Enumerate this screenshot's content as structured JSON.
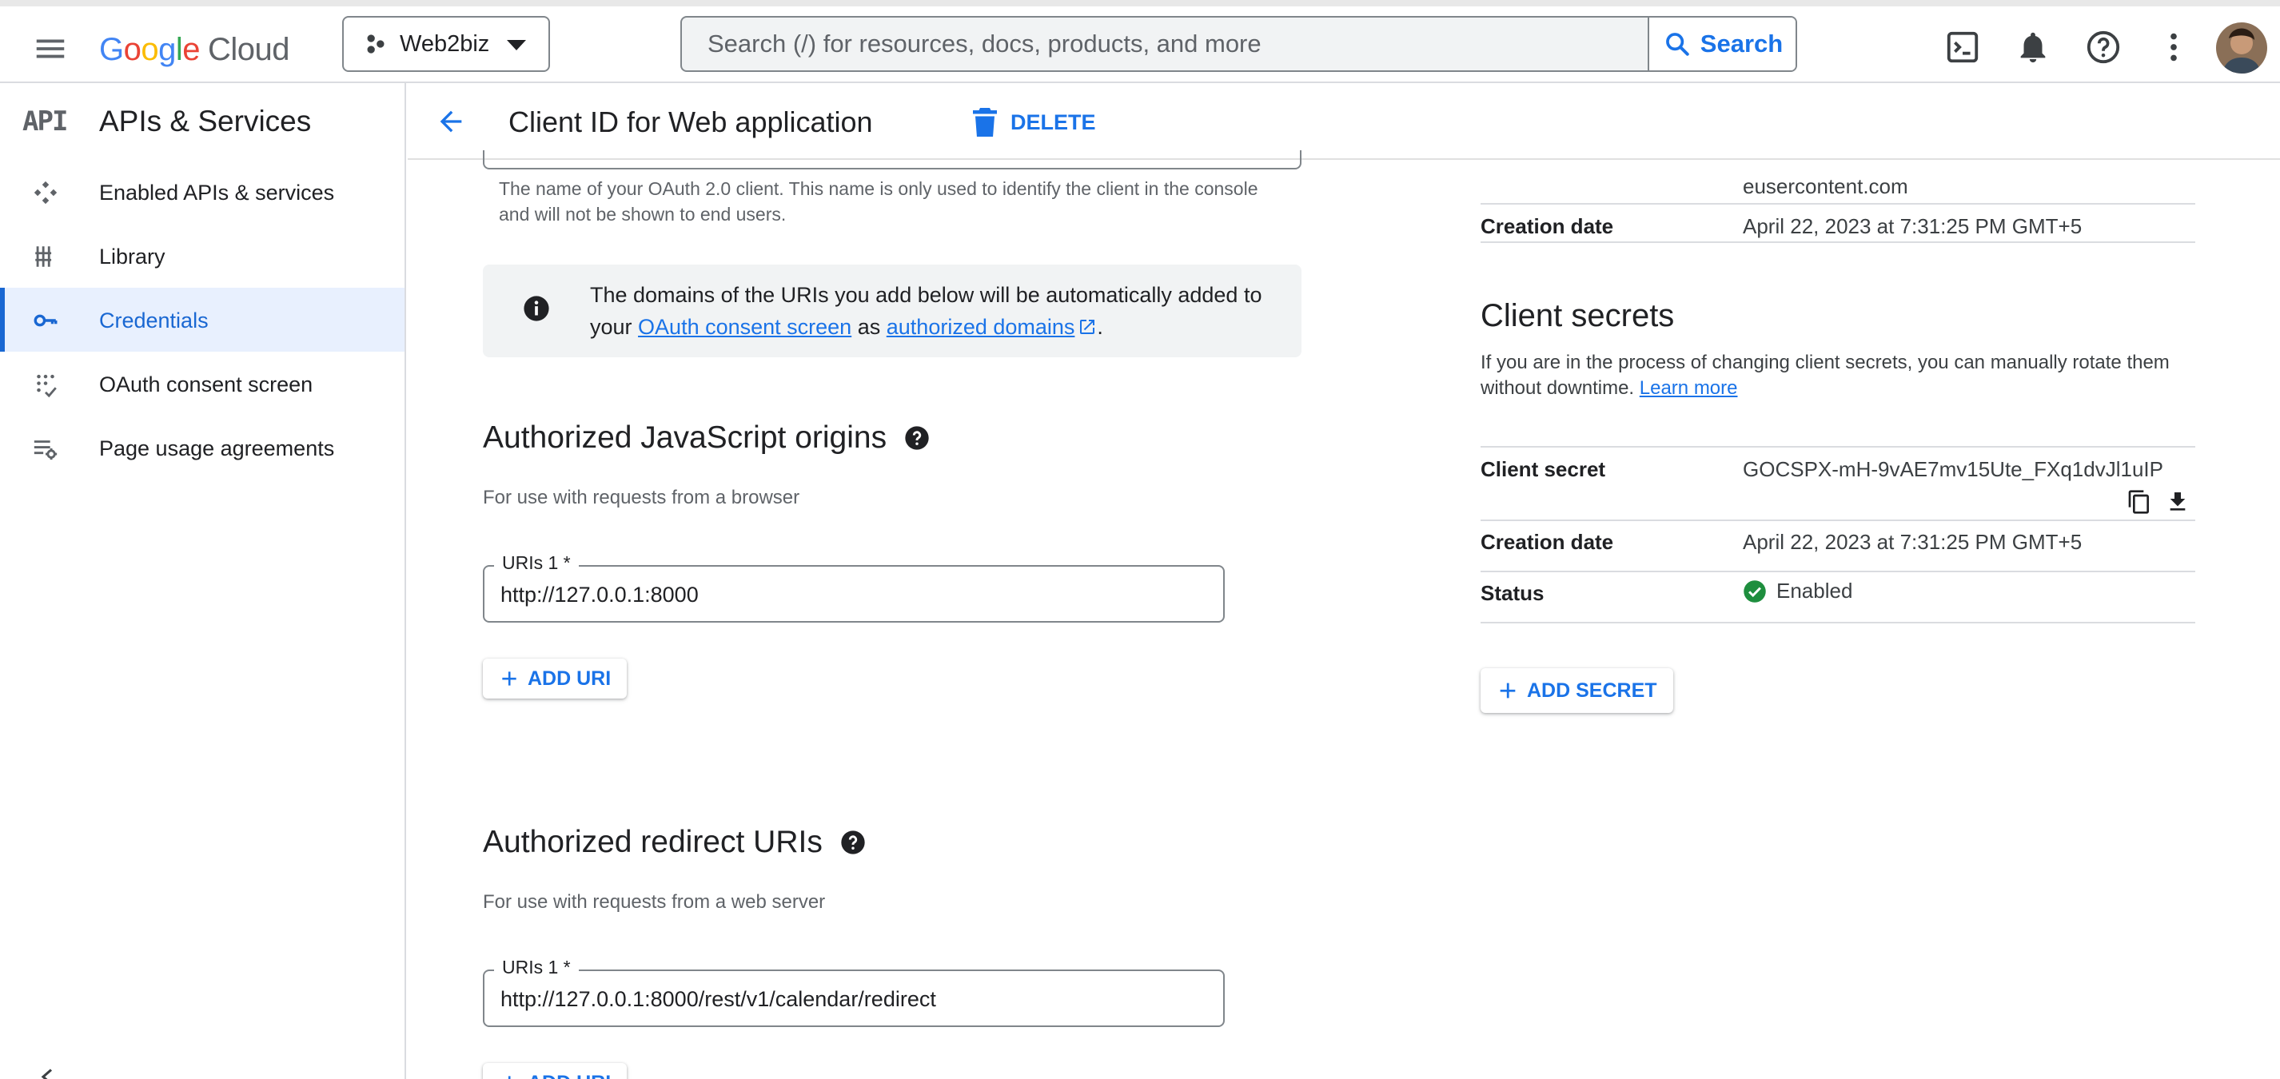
{
  "topbar": {
    "logo_google": "Google",
    "logo_cloud": "Cloud",
    "project": "Web2biz",
    "search_placeholder": "Search (/) for resources, docs, products, and more",
    "search_button": "Search",
    "icons": [
      "cloud-shell-icon",
      "notifications-icon",
      "help-icon",
      "more-vert-icon"
    ]
  },
  "sidebar": {
    "badge": "API",
    "title": "APIs & Services",
    "items": [
      {
        "label": "Enabled APIs & services",
        "icon": "enabled-apis-icon"
      },
      {
        "label": "Library",
        "icon": "library-icon"
      },
      {
        "label": "Credentials",
        "icon": "key-icon",
        "active": true
      },
      {
        "label": "OAuth consent screen",
        "icon": "consent-icon"
      },
      {
        "label": "Page usage agreements",
        "icon": "settings-list-icon"
      }
    ]
  },
  "header": {
    "title": "Client ID for Web application",
    "delete_label": "DELETE"
  },
  "left": {
    "name_helper": "The name of your OAuth 2.0 client. This name is only used to identify the client in the console and will not be shown to end users.",
    "info_text_1": "The domains of the URIs you add below will be automatically added to your",
    "info_link_1": "OAuth consent screen",
    "info_text_2": "as",
    "info_link_2": "authorized domains",
    "info_text_3": ".",
    "js_origins": {
      "title": "Authorized JavaScript origins",
      "subtitle": "For use with requests from a browser",
      "field_label": "URIs 1 *",
      "field_value": "http://127.0.0.1:8000",
      "add_label": "ADD URI"
    },
    "redirect": {
      "title": "Authorized redirect URIs",
      "subtitle": "For use with requests from a web server",
      "field_label": "URIs 1 *",
      "field_value": "http://127.0.0.1:8000/rest/v1/calendar/redirect",
      "add_label": "ADD URI"
    }
  },
  "right": {
    "client_id_tail": "eusercontent.com",
    "client_creation_label": "Creation date",
    "client_creation_value": "April 22, 2023 at 7:31:25 PM GMT+5",
    "secrets_title": "Client secrets",
    "secrets_desc": "If you are in the process of changing client secrets, you can manually rotate them without downtime.",
    "learn_more": "Learn more",
    "secret_label": "Client secret",
    "secret_value": "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",
    "secret_creation_label": "Creation date",
    "secret_creation_value": "April 22, 2023 at 7:31:25 PM GMT+5",
    "status_label": "Status",
    "status_value": "Enabled",
    "add_secret": "ADD SECRET"
  },
  "colors": {
    "accent": "#1a73e8",
    "active_bg": "#e8f0fe",
    "success": "#1e8e3e"
  }
}
